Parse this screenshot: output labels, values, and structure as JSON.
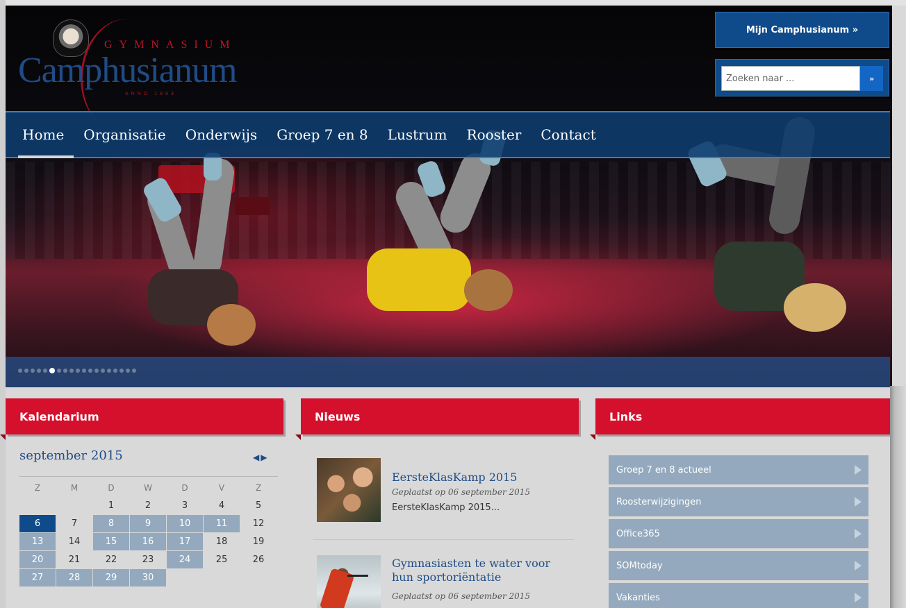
{
  "logo": {
    "top_text": "GYMNASIUM",
    "main_text": "Camphusianum",
    "sub_text": "ANNO 1993"
  },
  "header": {
    "mijn_button": "Mijn Camphusianum »",
    "search_placeholder": "Zoeken naar ...",
    "search_button": "»"
  },
  "nav": {
    "items": [
      "Home",
      "Organisatie",
      "Onderwijs",
      "Groep 7 en 8",
      "Lustrum",
      "Rooster",
      "Contact"
    ],
    "active_index": 0
  },
  "slider": {
    "dot_count": 19,
    "active_dot": 5
  },
  "kalendarium": {
    "heading": "Kalendarium",
    "month": "september 2015",
    "weekdays": [
      "Z",
      "M",
      "D",
      "W",
      "D",
      "V",
      "Z"
    ],
    "weeks": [
      [
        "",
        "",
        "1",
        "2",
        "3",
        "4",
        "5"
      ],
      [
        "6",
        "7",
        "8",
        "9",
        "10",
        "11",
        "12"
      ],
      [
        "13",
        "14",
        "15",
        "16",
        "17",
        "18",
        "19"
      ],
      [
        "20",
        "21",
        "22",
        "23",
        "24",
        "25",
        "26"
      ],
      [
        "27",
        "28",
        "29",
        "30",
        "",
        "",
        ""
      ]
    ],
    "today": "6",
    "event_days": [
      "8",
      "9",
      "10",
      "11",
      "13",
      "15",
      "16",
      "17",
      "20",
      "24",
      "27",
      "28",
      "29",
      "30"
    ]
  },
  "nieuws": {
    "heading": "Nieuws",
    "items": [
      {
        "title": "EersteKlasKamp 2015",
        "date": "Geplaatst op 06 september 2015",
        "excerpt": "EersteKlasKamp 2015..."
      },
      {
        "title": "Gymnasiasten te water voor hun sportoriëntatie",
        "date": "Geplaatst op 06 september 2015",
        "excerpt": ""
      }
    ]
  },
  "links": {
    "heading": "Links",
    "items": [
      "Groep 7 en 8 actueel",
      "Roosterwijzigingen",
      "Office365",
      "SOMtoday",
      "Vakanties"
    ]
  },
  "colors": {
    "brand_blue": "#0f4b8a",
    "brand_red": "#d5102c",
    "calendar_event": "#94a9bd"
  }
}
